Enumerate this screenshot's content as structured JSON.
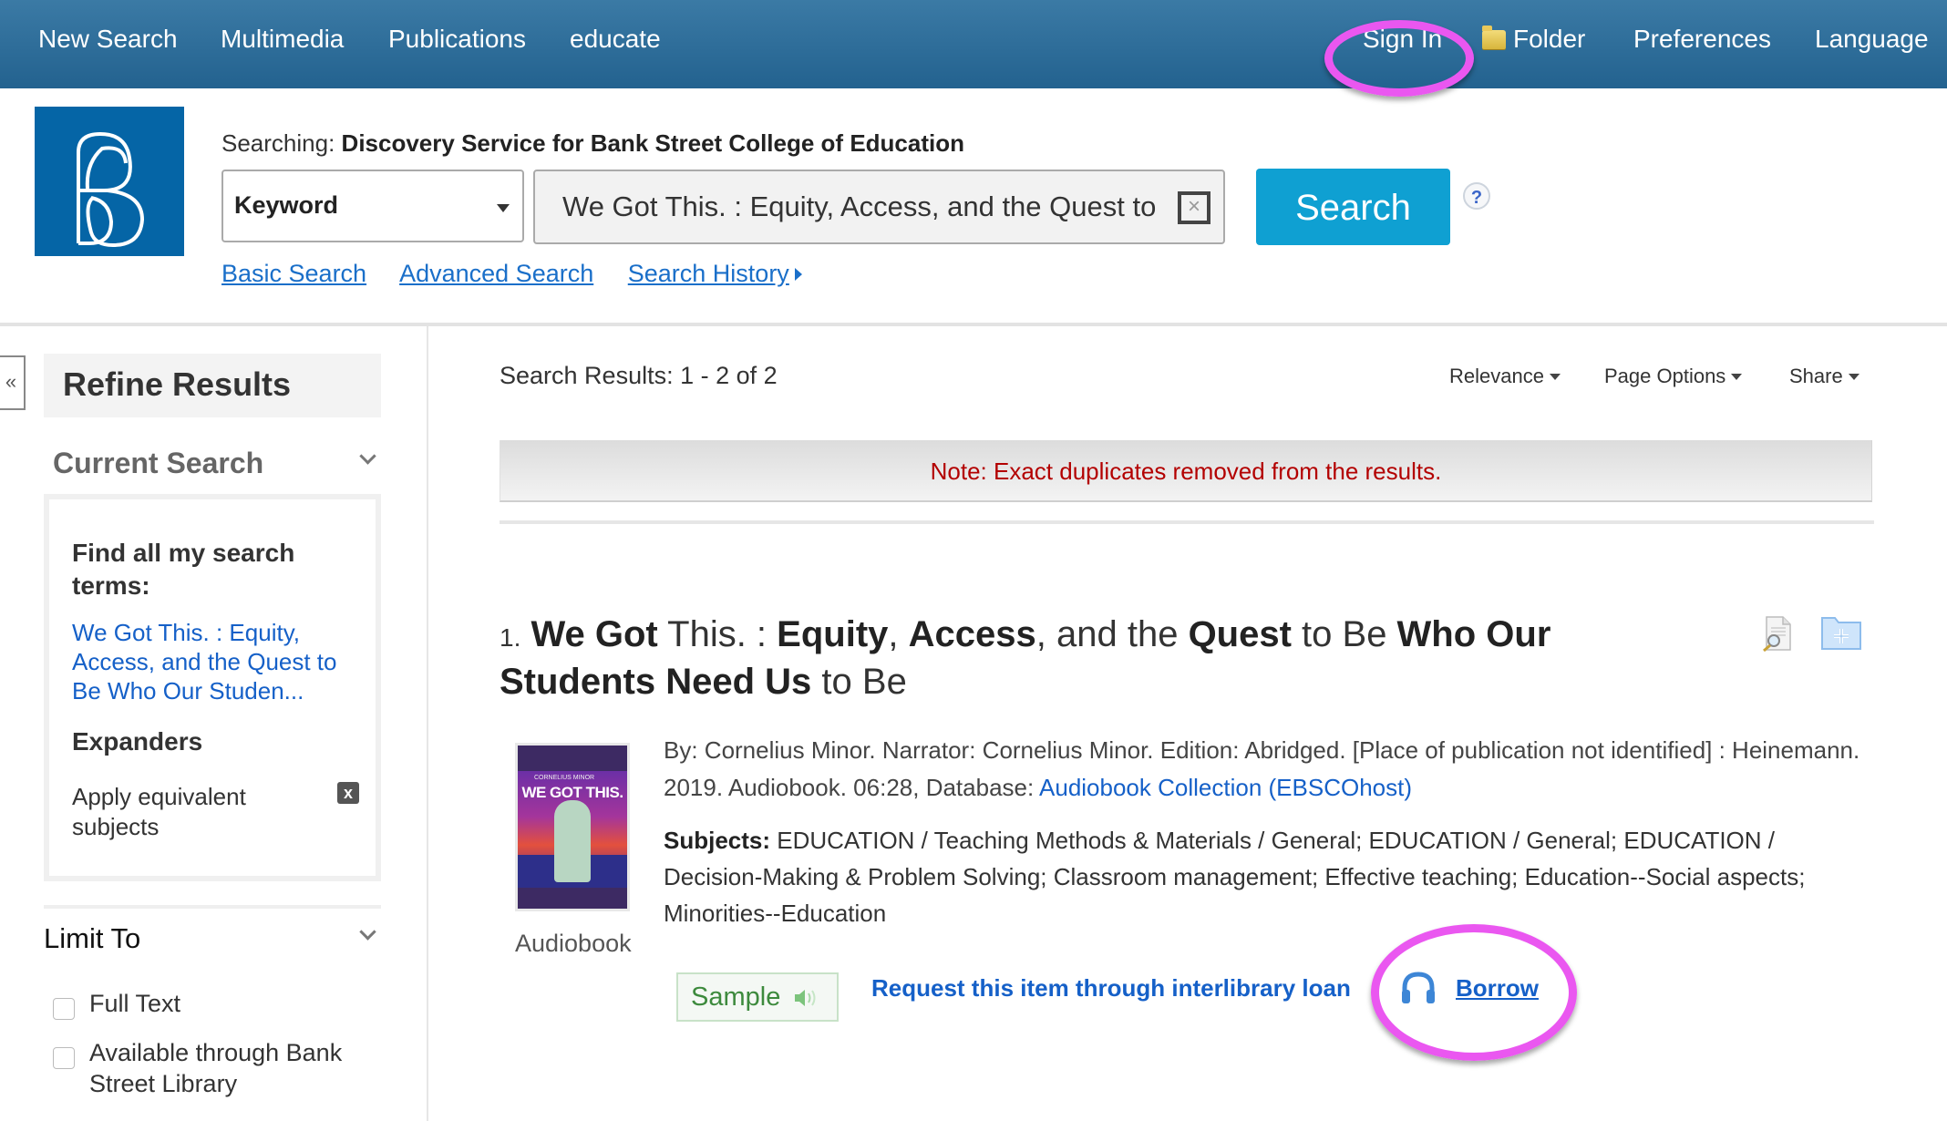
{
  "nav": {
    "left_items": [
      "New Search",
      "Multimedia",
      "Publications",
      "educate"
    ],
    "sign_in": "Sign In",
    "folder": "Folder",
    "preferences": "Preferences",
    "language": "Language",
    "bg_color": "#2b6a96"
  },
  "header": {
    "logo_alt": "Bank Street College of Education logo",
    "searching_label": "Searching:",
    "searching_target": "Discovery Service for Bank Street College of Education",
    "field_select": "Keyword",
    "query_value": "We Got This. : Equity, Access, and the Quest to Be Who Our Students Need Us to Be",
    "clear_glyph": "×",
    "search_button": "Search",
    "help_glyph": "?",
    "links": {
      "basic": "Basic Search",
      "advanced": "Advanced Search",
      "history": "Search History"
    }
  },
  "sidebar": {
    "collapse_glyph": "«",
    "refine_title": "Refine Results",
    "current_search": {
      "heading": "Current Search",
      "find_all_label": "Find all my search terms:",
      "query_link": "We Got This. : Equity, Access, and the Quest to Be Who Our Studen...",
      "expanders_label": "Expanders",
      "expander_item": "Apply equivalent subjects",
      "remove_glyph": "x"
    },
    "limit_to": {
      "heading": "Limit To",
      "options": [
        {
          "label": "Full Text",
          "checked": false
        },
        {
          "label": "Available through Bank Street Library",
          "checked": false
        }
      ]
    }
  },
  "results": {
    "count_label": "Search Results: 1 - 2 of 2",
    "tools": [
      "Relevance",
      "Page Options",
      "Share"
    ],
    "note": "Note: Exact duplicates removed from the results.",
    "items": [
      {
        "number": "1.",
        "title_parts": [
          {
            "text": "We Got",
            "bold": true
          },
          {
            "text": " This. : ",
            "bold": false
          },
          {
            "text": "Equity",
            "bold": true
          },
          {
            "text": ", ",
            "bold": false
          },
          {
            "text": "Access",
            "bold": true
          },
          {
            "text": ", and the ",
            "bold": false
          },
          {
            "text": "Quest",
            "bold": true
          },
          {
            "text": " to Be ",
            "bold": false
          },
          {
            "text": "Who Our Students Need Us",
            "bold": true
          },
          {
            "text": " to Be",
            "bold": false
          }
        ],
        "cover_title": "WE GOT THIS.",
        "cover_author": "CORNELIUS MINOR",
        "format": "Audiobook",
        "details_text": "By: Cornelius Minor. Narrator: Cornelius Minor. Edition: Abridged. [Place of publication not identified] : Heinemann. 2019. Audiobook. 06:28, Database: ",
        "database_link": "Audiobook Collection (EBSCOhost)",
        "subjects_label": "Subjects:",
        "subjects_text": "EDUCATION / Teaching Methods & Materials / General; EDUCATION / General; EDUCATION / Decision-Making & Problem Solving; Classroom management; Effective teaching; Education--Social aspects; Minorities--Education",
        "sample_button": "Sample",
        "ill_link": "Request this item through interlibrary loan",
        "borrow_link": "Borrow"
      }
    ]
  },
  "annotations": {
    "highlight_color": "#ea57f0",
    "highlighted": [
      "Sign In",
      "Borrow"
    ]
  }
}
